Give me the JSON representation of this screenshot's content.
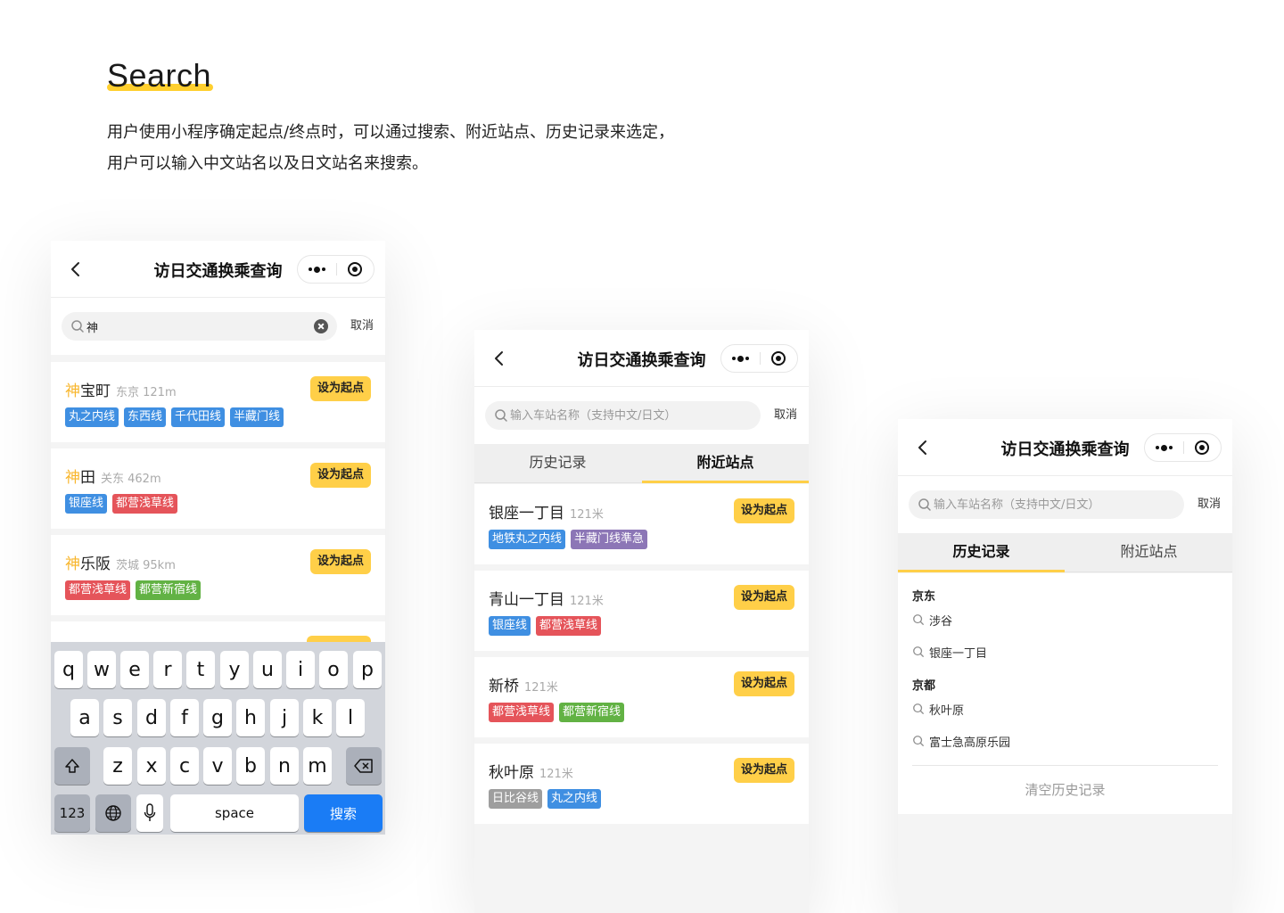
{
  "heading": {
    "title": "Search"
  },
  "intro": {
    "line1": "用户使用小程序确定起点/终点时，可以通过搜索、附近站点、历史记录来选定，",
    "line2": "用户可以输入中文站名以及日文站名来搜索。"
  },
  "colors": {
    "accent": "#ffcf48",
    "highlight": "#f8b62c",
    "blue": "#3f8fe2",
    "red": "#e5545a",
    "purple": "#8c76b6",
    "green": "#62b244",
    "gray": "#9e9e9e",
    "keyboard_go": "#1a7cf5"
  },
  "icons": [
    "back-chevron-icon",
    "more-dots-icon",
    "close-target-icon",
    "search-icon",
    "clear-icon",
    "shift-icon",
    "backspace-icon",
    "globe-icon",
    "microphone-icon"
  ],
  "phone1": {
    "nav_title": "访日交通换乘查询",
    "search": {
      "value": "神",
      "placeholder": ""
    },
    "cancel": "取消",
    "results": [
      {
        "highlight": "神",
        "rest": "宝町",
        "meta": "东京  121m",
        "button": "设为起点",
        "tags": [
          {
            "label": "丸之内线"
          },
          {
            "label": "东西线"
          },
          {
            "label": "千代田线"
          },
          {
            "label": "半藏门线"
          }
        ]
      },
      {
        "highlight": "神",
        "rest": "田",
        "meta": "关东  462m",
        "button": "设为起点",
        "tags": [
          {
            "label": "银座线"
          },
          {
            "label": "都营浅草线"
          }
        ]
      },
      {
        "highlight": "神",
        "rest": "乐阪",
        "meta": "茨城  95km",
        "button": "设为起点",
        "tags": [
          {
            "label": "都营浅草线"
          },
          {
            "label": "都营新宿线"
          }
        ]
      }
    ],
    "keyboard": {
      "row1": [
        "q",
        "w",
        "e",
        "r",
        "t",
        "y",
        "u",
        "i",
        "o",
        "p"
      ],
      "row2": [
        "a",
        "s",
        "d",
        "f",
        "g",
        "h",
        "j",
        "k",
        "l"
      ],
      "row3": [
        "z",
        "x",
        "c",
        "v",
        "b",
        "n",
        "m"
      ],
      "num_key": "123",
      "space_key": "space",
      "go_key": "搜索"
    }
  },
  "phone2": {
    "nav_title": "访日交通换乘查询",
    "search": {
      "placeholder": "输入车站名称（支持中文/日文）"
    },
    "cancel": "取消",
    "tabs": [
      "历史记录",
      "附近站点"
    ],
    "active_tab": "附近站点",
    "stations": [
      {
        "name": "银座一丁目",
        "distance": "121米",
        "button": "设为起点",
        "tags": [
          {
            "label": "地铁丸之内线"
          },
          {
            "label": "半藏门线準急"
          }
        ]
      },
      {
        "name": "青山一丁目",
        "distance": "121米",
        "button": "设为起点",
        "tags": [
          {
            "label": "银座线"
          },
          {
            "label": "都营浅草线"
          }
        ]
      },
      {
        "name": "新桥",
        "distance": "121米",
        "button": "设为起点",
        "tags": [
          {
            "label": "都营浅草线"
          },
          {
            "label": "都营新宿线"
          }
        ]
      },
      {
        "name": "秋叶原",
        "distance": "121米",
        "button": "设为起点",
        "tags": [
          {
            "label": "日比谷线"
          },
          {
            "label": "丸之内线"
          }
        ]
      }
    ]
  },
  "phone3": {
    "nav_title": "访日交通换乘查询",
    "search": {
      "placeholder": "输入车站名称（支持中文/日文）"
    },
    "cancel": "取消",
    "tabs": [
      "历史记录",
      "附近站点"
    ],
    "active_tab": "历史记录",
    "history": {
      "group1": "京东",
      "group1_items": [
        "涉谷",
        "银座一丁目"
      ],
      "group2": "京都",
      "group2_items": [
        "秋叶原",
        "富士急高原乐园"
      ],
      "clear": "清空历史记录"
    }
  }
}
